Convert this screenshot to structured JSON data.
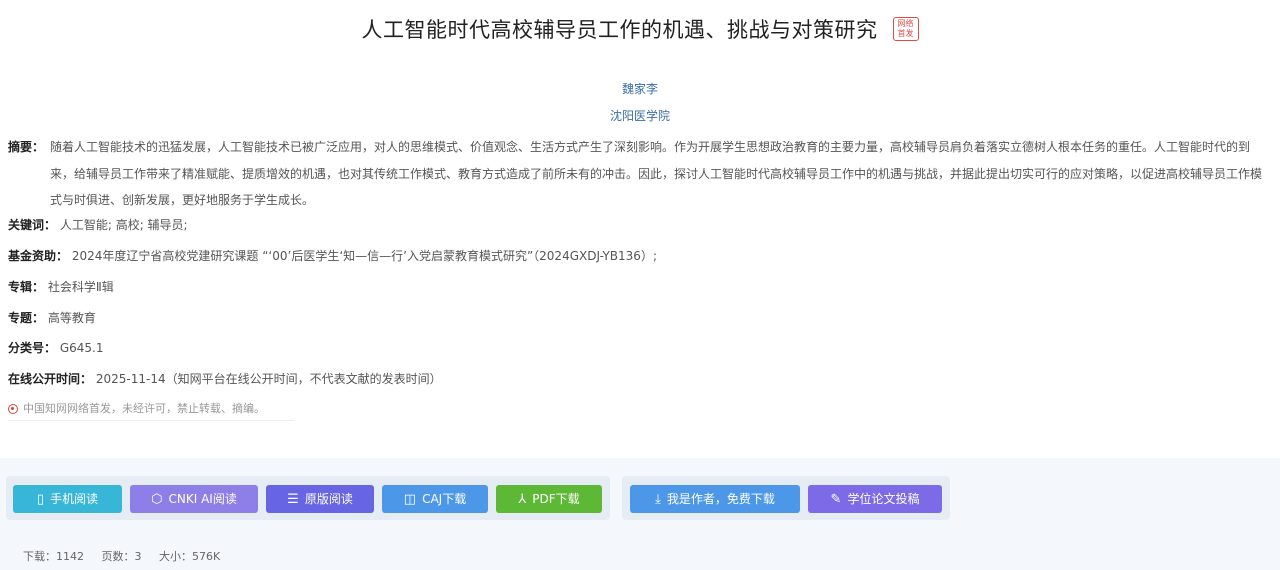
{
  "article": {
    "title": "人工智能时代高校辅导员工作的机遇、挑战与对策研究",
    "first_pub_badge": [
      "网络",
      "首发"
    ],
    "author": "魏家李",
    "organization": "沈阳医学院"
  },
  "abstract": {
    "label": "摘要：",
    "text": "随着人工智能技术的迅猛发展，人工智能技术已被广泛应用，对人的思维模式、价值观念、生活方式产生了深刻影响。作为开展学生思想政治教育的主要力量，高校辅导员肩负着落实立德树人根本任务的重任。人工智能时代的到来，给辅导员工作带来了精准赋能、提质增效的机遇，也对其传统工作模式、教育方式造成了前所未有的冲击。因此，探讨人工智能时代高校辅导员工作中的机遇与挑战，并据此提出切实可行的应对策略，以促进高校辅导员工作模式与时俱进、创新发展，更好地服务于学生成长。"
  },
  "fields": {
    "keywords_label": "关键词：",
    "keywords": "人工智能;  高校;  辅导员;",
    "fund_label": "基金资助：",
    "fund": "2024年度辽宁省高校党建研究课题 “‘00’后医学生‘知—信—行’入党启蒙教育模式研究”（2024GXDJ-YB136）;",
    "series_label": "专辑：",
    "series": "社会科学Ⅱ辑",
    "topic_label": "专题：",
    "topic": "高等教育",
    "class_label": "分类号：",
    "class_no": "G645.1",
    "online_label": "在线公开时间：",
    "online_date": "2025-11-14（知网平台在线公开时间，不代表文献的发表时间）"
  },
  "notice": "中国知网网络首发，未经许可，禁止转载、摘编。",
  "buttons": {
    "mobile": "手机阅读",
    "cnki_ai": "CNKI AI阅读",
    "original": "原版阅读",
    "caj": "CAJ下载",
    "pdf": "PDF下载",
    "author_download": "我是作者，免费下载",
    "thesis_submit": "学位论文投稿"
  },
  "stats": {
    "downloads": "下载：1142",
    "pages": "页数：3",
    "size": "大小：576K"
  },
  "icons": {
    "mobile": "phone-icon",
    "cnki_ai": "ai-icon",
    "original": "book-icon",
    "caj": "open-book-icon",
    "pdf": "pdf-icon",
    "author_download": "download-icon",
    "thesis_submit": "pen-icon",
    "notice": "target-icon"
  },
  "colors": {
    "mobile": "#37b6d8",
    "cnki_ai": "#8e7ee8",
    "original": "#6765e3",
    "caj": "#4d97e9",
    "pdf": "#5db836",
    "author_download": "#4d97e9",
    "thesis_submit": "#7c6ae6",
    "link": "#3a6ea5",
    "badge": "#e34a4a"
  }
}
